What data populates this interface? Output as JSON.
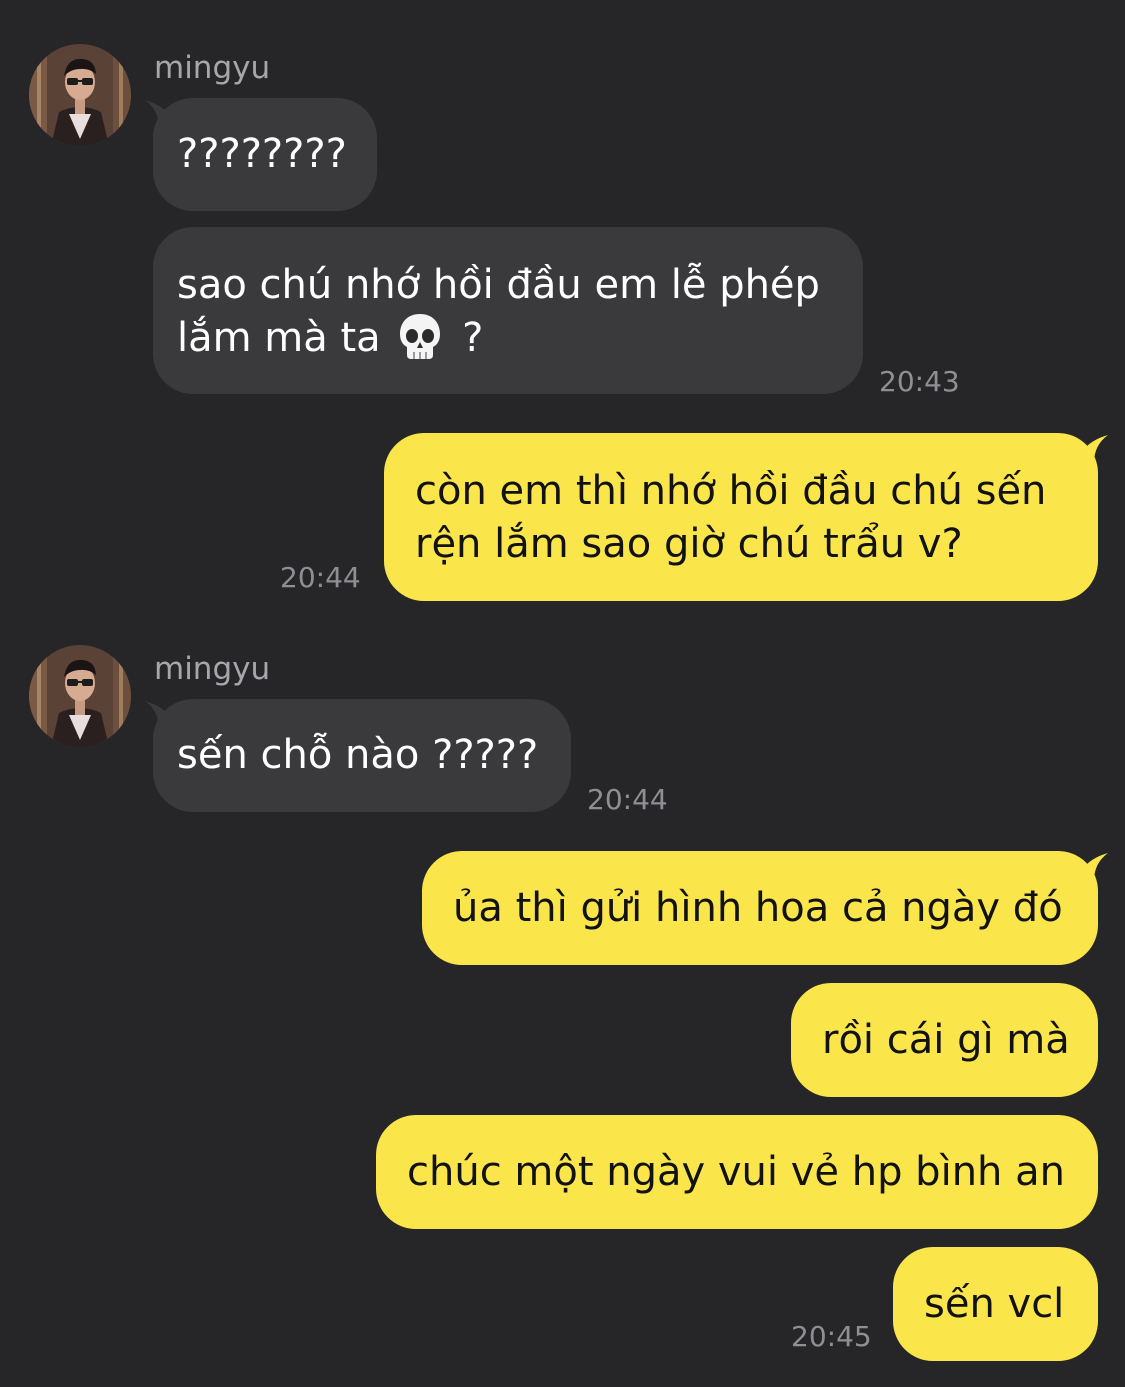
{
  "contact": {
    "name": "mingyu",
    "avatar_icon": "profile-photo"
  },
  "colors": {
    "background": "#262628",
    "incoming_bubble": "#3a3a3c",
    "outgoing_bubble": "#fae64b",
    "timestamp": "#8f8f93"
  },
  "messages": [
    {
      "id": "m1",
      "direction": "incoming",
      "sender": "mingyu",
      "lines": [
        "????????"
      ]
    },
    {
      "id": "m2",
      "direction": "incoming",
      "lines": [
        "sao chú nhớ hồi đầu em lễ phép",
        "lắm mà ta",
        "?"
      ],
      "emoji": "skull-icon",
      "time": "20:43"
    },
    {
      "id": "m3",
      "direction": "outgoing",
      "lines": [
        "còn em thì nhớ hồi đầu chú sến",
        "rện lắm sao giờ chú trẩu v?"
      ],
      "time": "20:44"
    },
    {
      "id": "m4",
      "direction": "incoming",
      "sender": "mingyu",
      "lines": [
        "sến chỗ nào ?????"
      ],
      "time": "20:44"
    },
    {
      "id": "m5",
      "direction": "outgoing",
      "lines": [
        "ủa thì gửi hình hoa cả ngày đó"
      ]
    },
    {
      "id": "m6",
      "direction": "outgoing",
      "lines": [
        "rồi cái gì mà"
      ]
    },
    {
      "id": "m7",
      "direction": "outgoing",
      "lines": [
        "chúc một ngày vui vẻ hp bình an"
      ]
    },
    {
      "id": "m8",
      "direction": "outgoing",
      "lines": [
        "sến vcl"
      ],
      "time": "20:45"
    }
  ]
}
